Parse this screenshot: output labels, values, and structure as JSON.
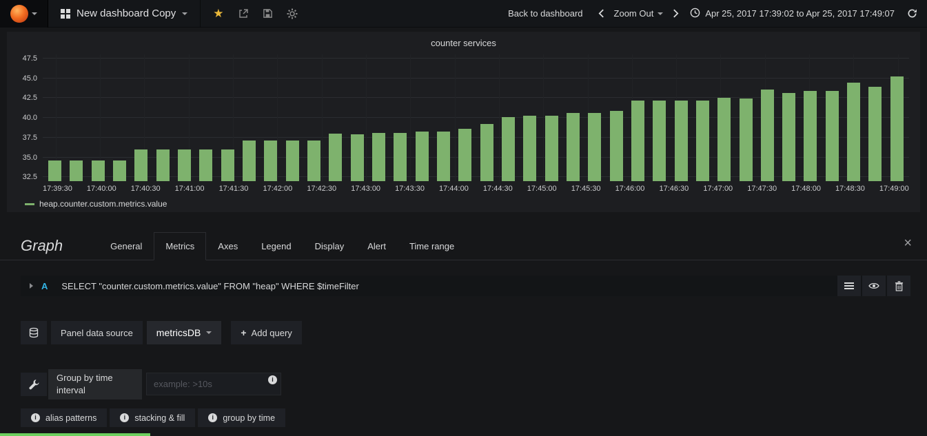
{
  "colors": {
    "bar_green": "#7eb26d",
    "accent_blue": "#33b5e5",
    "star_yellow": "#eab839",
    "strip_green": "#6ccf5e"
  },
  "navbar": {
    "dashboard_title": "New dashboard Copy",
    "back_to_dashboard": "Back to dashboard",
    "zoom_out_label": "Zoom Out",
    "time_range": "Apr 25, 2017 17:39:02 to Apr 25, 2017 17:49:07"
  },
  "chart_data": {
    "type": "bar",
    "title": "counter services",
    "legend": "heap.counter.custom.metrics.value",
    "ylim": [
      32,
      48
    ],
    "yticks": [
      47.5,
      45.0,
      42.5,
      40.0,
      37.5,
      35.0,
      32.5
    ],
    "x_tick_labels": [
      "17:39:30",
      "17:40:00",
      "17:40:30",
      "17:41:00",
      "17:41:30",
      "17:42:00",
      "17:42:30",
      "17:43:00",
      "17:43:30",
      "17:44:00",
      "17:44:30",
      "17:45:00",
      "17:45:30",
      "17:46:00",
      "17:46:30",
      "17:47:00",
      "17:47:30",
      "17:48:00",
      "17:48:30",
      "17:49:00"
    ],
    "values": [
      34.6,
      34.6,
      34.6,
      34.6,
      36.0,
      36.0,
      36.0,
      36.0,
      36.0,
      37.1,
      37.1,
      37.1,
      37.1,
      38.0,
      37.9,
      38.1,
      38.1,
      38.3,
      38.3,
      38.6,
      39.2,
      40.1,
      40.3,
      40.3,
      40.6,
      40.6,
      40.9,
      42.2,
      42.2,
      42.2,
      42.2,
      42.5,
      42.4,
      43.6,
      43.1,
      43.4,
      43.4,
      44.4,
      43.9,
      45.2
    ],
    "grid": true,
    "legend_position": "bottom-left"
  },
  "editor": {
    "panel_type_label": "Graph",
    "tabs": [
      "General",
      "Metrics",
      "Axes",
      "Legend",
      "Display",
      "Alert",
      "Time range"
    ],
    "active_tab": "Metrics",
    "query": {
      "ref_id": "A",
      "text": "SELECT \"counter.custom.metrics.value\" FROM \"heap\" WHERE $timeFilter"
    },
    "datasource_row": {
      "panel_data_source_label": "Panel data source",
      "datasource_selected": "metricsDB",
      "add_query_label": "Add query"
    },
    "group_by": {
      "label": "Group by time interval",
      "placeholder": "example: >10s"
    },
    "help_buttons": [
      "alias patterns",
      "stacking & fill",
      "group by time"
    ]
  }
}
